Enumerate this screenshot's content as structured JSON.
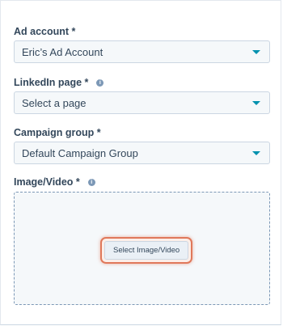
{
  "form": {
    "ad_account": {
      "label": "Ad account *",
      "value": "Eric’s Ad Account"
    },
    "linkedin_page": {
      "label": "LinkedIn page *",
      "value": "Select a page"
    },
    "campaign_group": {
      "label": "Campaign group *",
      "value": "Default Campaign Group"
    },
    "image_video": {
      "label": "Image/Video *",
      "button_label": "Select Image/Video"
    }
  },
  "colors": {
    "accent": "#0091ae",
    "highlight": "#e0785a",
    "text": "#33475b"
  },
  "icons": [
    "info-icon",
    "chevron-down-icon"
  ]
}
